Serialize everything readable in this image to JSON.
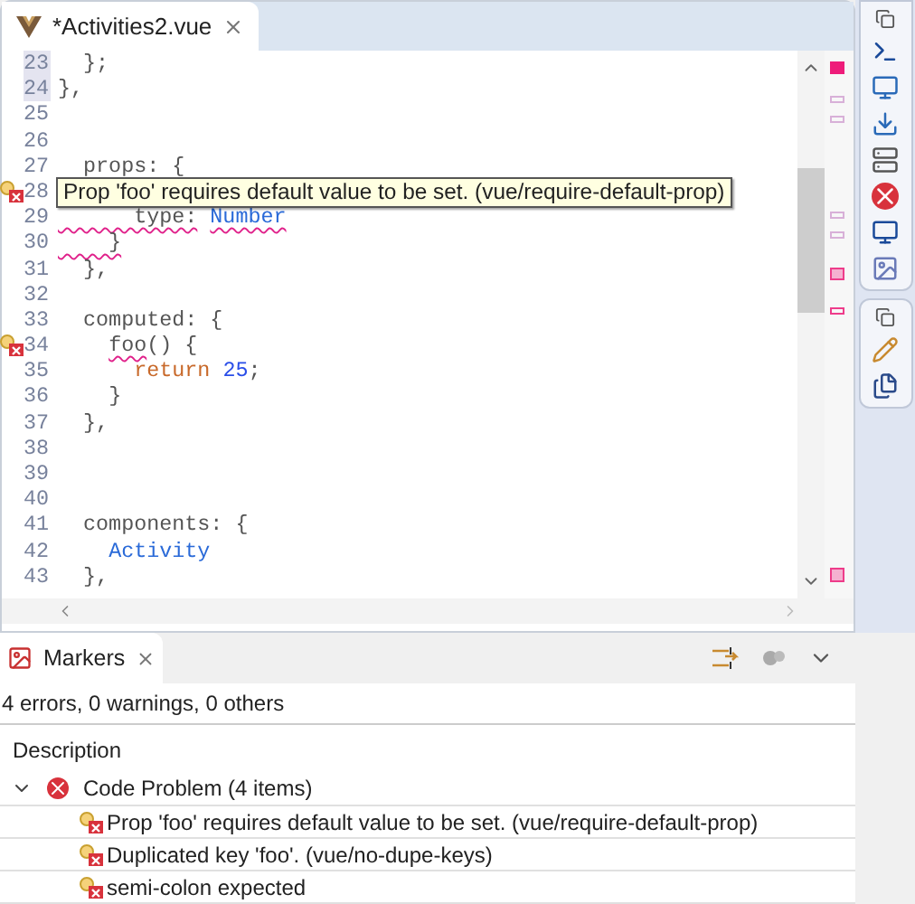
{
  "editor": {
    "tab": {
      "title": "*Activities2.vue",
      "selected": true
    },
    "lines": [
      {
        "number": "23",
        "highlighted": true,
        "error": false,
        "tokens": [
          {
            "text": "  };",
            "kind": "plain",
            "squiggle": false
          }
        ]
      },
      {
        "number": "24",
        "highlighted": true,
        "error": false,
        "tokens": [
          {
            "text": "},",
            "kind": "plain",
            "squiggle": false
          }
        ]
      },
      {
        "number": "25",
        "highlighted": false,
        "error": false
      },
      {
        "number": "26",
        "highlighted": false,
        "error": false
      },
      {
        "number": "27",
        "highlighted": false,
        "error": false,
        "tokens": [
          {
            "text": "  props: {",
            "kind": "plain",
            "squiggle": false
          }
        ]
      },
      {
        "number": "28",
        "highlighted": false,
        "error": true
      },
      {
        "number": "29",
        "highlighted": false,
        "error": false,
        "tokens": [
          {
            "text": "      type:",
            "kind": "plain",
            "squiggle": true
          },
          {
            "text": " Number",
            "kind": "ident",
            "squiggle": true
          }
        ]
      },
      {
        "number": "30",
        "highlighted": false,
        "error": false,
        "tokens": [
          {
            "text": "    }",
            "kind": "plain",
            "squiggle": true
          }
        ]
      },
      {
        "number": "31",
        "highlighted": false,
        "error": false,
        "tokens": [
          {
            "text": "  },",
            "kind": "plain",
            "squiggle": false
          }
        ]
      },
      {
        "number": "32",
        "highlighted": false,
        "error": false
      },
      {
        "number": "33",
        "highlighted": false,
        "error": false,
        "tokens": [
          {
            "text": "  computed: {",
            "kind": "plain",
            "squiggle": false
          }
        ]
      },
      {
        "number": "34",
        "highlighted": false,
        "error": true,
        "tokens": [
          {
            "text": "    foo",
            "kind": "plain",
            "squiggle": true
          },
          {
            "text": "() {",
            "kind": "plain",
            "squiggle": false
          }
        ]
      },
      {
        "number": "35",
        "highlighted": false,
        "error": false,
        "tokens": [
          {
            "text": "      return",
            "kind": "keyword",
            "squiggle": false
          },
          {
            "text": " 25",
            "kind": "number",
            "squiggle": false
          },
          {
            "text": ";",
            "kind": "plain",
            "squiggle": false
          }
        ]
      },
      {
        "number": "36",
        "highlighted": false,
        "error": false,
        "tokens": [
          {
            "text": "    }",
            "kind": "plain",
            "squiggle": false
          }
        ]
      },
      {
        "number": "37",
        "highlighted": false,
        "error": false,
        "tokens": [
          {
            "text": "  },",
            "kind": "plain",
            "squiggle": false
          }
        ]
      },
      {
        "number": "38",
        "highlighted": false,
        "error": false
      },
      {
        "number": "39",
        "highlighted": false,
        "error": false
      },
      {
        "number": "40",
        "highlighted": false,
        "error": false
      },
      {
        "number": "41",
        "highlighted": false,
        "error": false,
        "tokens": [
          {
            "text": "  components: {",
            "kind": "plain",
            "squiggle": false
          }
        ]
      },
      {
        "number": "42",
        "highlighted": false,
        "error": false,
        "tokens": [
          {
            "text": "    Activity",
            "kind": "ident",
            "squiggle": false
          }
        ]
      },
      {
        "number": "43",
        "highlighted": false,
        "error": false,
        "tokens": [
          {
            "text": "  },",
            "kind": "plain",
            "squiggle": false
          }
        ]
      }
    ],
    "tooltip": "Prop 'foo' requires default value to be set. (vue/require-default-prop)"
  },
  "markers": {
    "tab": {
      "title": "Markers",
      "selected": true
    },
    "summary": "4 errors, 0 warnings, 0 others",
    "column": "Description",
    "groups": [
      {
        "label": "Code Problem (4 items)",
        "expanded": true,
        "children": [
          {
            "label": "Prop 'foo' requires default value to be set. (vue/require-default-prop)"
          },
          {
            "label": "Duplicated key 'foo'. (vue/no-dupe-keys)"
          },
          {
            "label": "semi-colon expected"
          }
        ]
      }
    ]
  }
}
